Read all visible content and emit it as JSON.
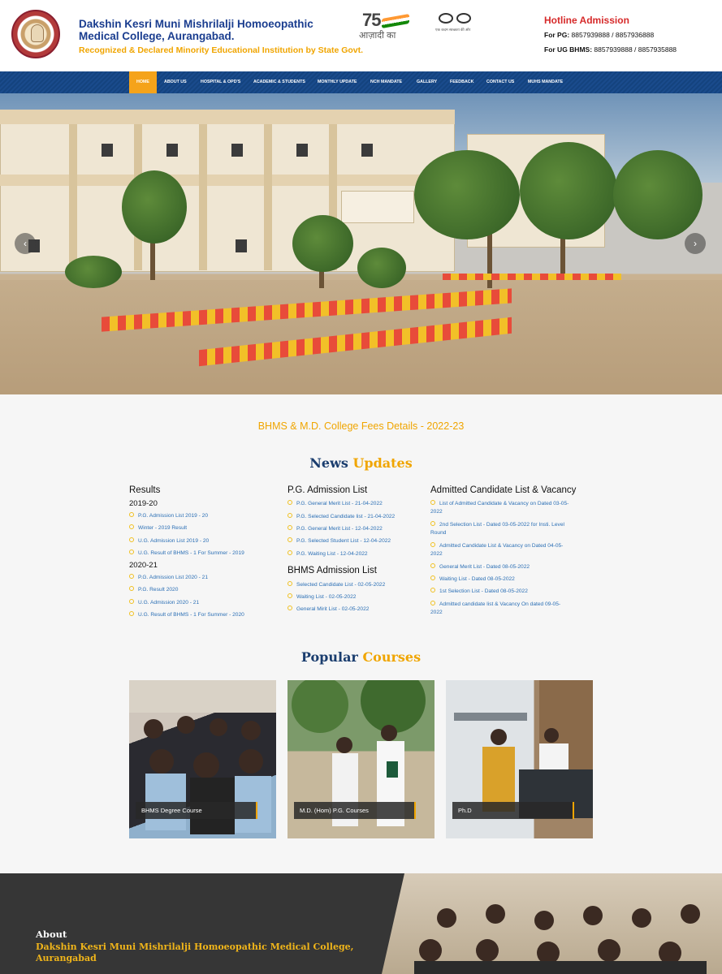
{
  "header": {
    "college_name": "Dakshin Kesri Muni Mishrilalji Homoeopathic Medical College, Aurangabad.",
    "tagline": "Recognized & Declared Minority Educational Institution by State Govt.",
    "azadi_number": "75",
    "azadi_text": "आज़ादी का",
    "swachh_text": "एक कदम स्वच्छता की ओर",
    "hotline_title": "Hotline Admission",
    "pg_label": "For PG:",
    "pg_numbers": "8857939888 / 8857936888",
    "ug_label": "For UG BHMS:",
    "ug_numbers": "8857939888 / 8857935888"
  },
  "nav": {
    "items": [
      {
        "label": "HOME"
      },
      {
        "label": "ABOUT US"
      },
      {
        "label": "HOSPITAL & OPD'S"
      },
      {
        "label": "ACADEMIC & STUDENTS"
      },
      {
        "label": "MONTHLY UPDATE"
      },
      {
        "label": "NCH MANDATE"
      },
      {
        "label": "GALLERY"
      },
      {
        "label": "FEEDBACK"
      },
      {
        "label": "CONTACT US"
      },
      {
        "label": "MUHS MANDATE"
      }
    ]
  },
  "slider": {
    "prev": "‹",
    "next": "›"
  },
  "fees_link": "BHMS & M.D. College Fees Details - 2022-23",
  "news": {
    "title_a": "News",
    "title_b": "Updates",
    "results": {
      "heading": "Results",
      "year1": "2019-20",
      "items1": [
        "P.G. Admission List 2019 - 20",
        "Winter - 2019 Result",
        "U.G. Admission List 2019 - 20",
        "U.G. Result of BHMS - 1 For Summer - 2019"
      ],
      "year2": "2020-21",
      "items2": [
        "P.G. Admission List 2020 - 21",
        "P.G. Result 2020",
        "U.G. Admission 2020 - 21",
        "U.G. Result of BHMS - 1 For Summer - 2020"
      ]
    },
    "pg": {
      "heading": "P.G. Admission List",
      "items": [
        "P.G. General Merit List - 21-04-2022",
        "P.G. Selected Candidate list - 21-04-2022",
        "P.G. General Merit List - 12-04-2022",
        "P.G. Selected Student List - 12-04-2022",
        "P.G. Waiting List - 12-04-2022"
      ]
    },
    "bhms": {
      "heading": "BHMS Admission List",
      "items": [
        "Selected Candidate List - 02-05-2022",
        "Waiting List - 02-05-2022",
        "General Mirit List - 02-05-2022"
      ]
    },
    "admitted": {
      "heading": "Admitted Candidate List & Vacancy",
      "items": [
        [
          "List of Admitted Candidate & Vacancy on Dated 03-05-",
          "2022"
        ],
        [
          "2nd Selection List - Dated 03-05-2022 for Insti. Level",
          "Round"
        ],
        [
          "Admitted Candidate List & Vacancy on Dated 04-05-",
          "2022"
        ],
        [
          "General Merit List - Dated 08-05-2022",
          ""
        ],
        [
          "Waiting List - Dated 08-05-2022",
          ""
        ],
        [
          "1st Selection List - Dated 08-05-2022",
          ""
        ],
        [
          "Admitted candidate list & Vacancy On dated 09-05-",
          "2022"
        ]
      ]
    }
  },
  "courses": {
    "title_a": "Popular",
    "title_b": "Courses",
    "items": [
      {
        "label": "BHMS Degree Course"
      },
      {
        "label": "M.D. (Hom) P.G. Courses"
      },
      {
        "label": "Ph.D"
      }
    ]
  },
  "footer": {
    "about_title": "About",
    "about_sub": "Dakshin Kesri Muni Mishrilalji Homoeopathic Medical College, Aurangabad"
  },
  "colors": {
    "brand_blue": "#1a4b8c",
    "accent_orange": "#f5a31a",
    "link_blue": "#2b6fb5",
    "hotline_red": "#d62a2a"
  }
}
